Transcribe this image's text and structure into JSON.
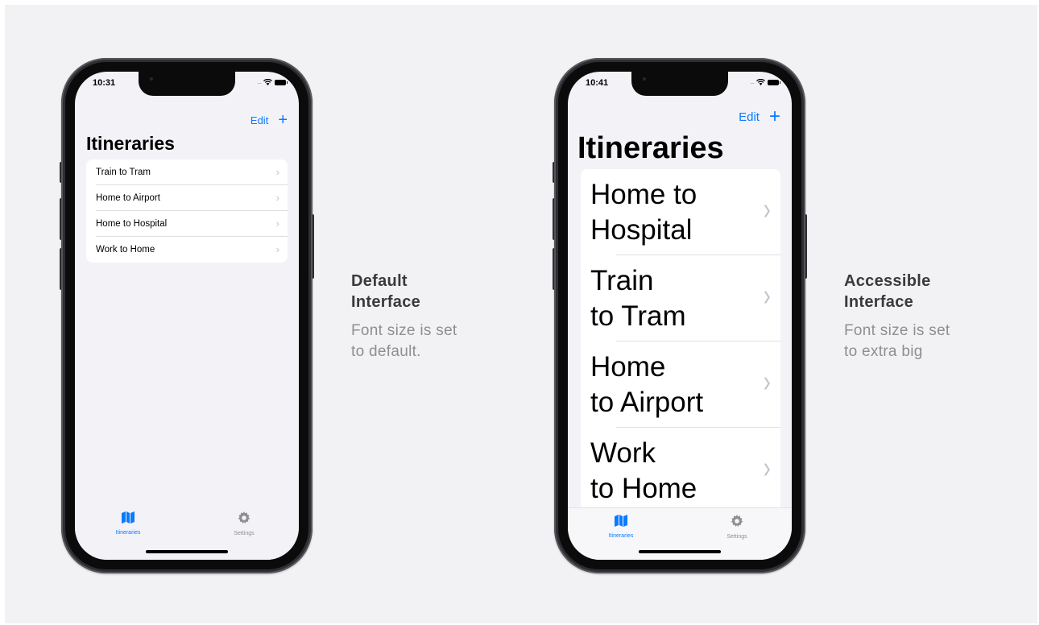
{
  "colors": {
    "accent": "#0a7aff",
    "background": "#f2f2f4",
    "phone_frame": "#2e2f33",
    "caption_heading": "#3a3a3c",
    "caption_text": "#8e8e93"
  },
  "phones": [
    {
      "status": {
        "time": "10:31",
        "signal": "....."
      },
      "nav": {
        "edit_label": "Edit",
        "add_label": "+"
      },
      "title": "Itineraries",
      "rows": [
        "Train to Tram",
        "Home to Airport",
        "Home to Hospital",
        "Work to Home"
      ],
      "tabs": [
        {
          "label": "Itineraries",
          "icon": "map-icon"
        },
        {
          "label": "Settings",
          "icon": "gear-icon"
        }
      ]
    },
    {
      "status": {
        "time": "10:41",
        "signal": "....."
      },
      "nav": {
        "edit_label": "Edit",
        "add_label": "+"
      },
      "title": "Itineraries",
      "rows": [
        {
          "line1": "Home to",
          "line2": "Hospital"
        },
        {
          "line1": "Train",
          "line2": "to Tram"
        },
        {
          "line1": "Home",
          "line2": "to Airport"
        },
        {
          "line1": "Work",
          "line2": "to Home"
        }
      ],
      "tabs": [
        {
          "label": "Itineraries",
          "icon": "map-icon"
        },
        {
          "label": "Settings",
          "icon": "gear-icon"
        }
      ]
    }
  ],
  "captions": [
    {
      "heading_line1": "Default",
      "heading_line2": "Interface",
      "desc_line1": "Font size is set",
      "desc_line2": "to default."
    },
    {
      "heading_line1": "Accessible",
      "heading_line2": "Interface",
      "desc_line1": "Font size is set",
      "desc_line2": "to extra big"
    }
  ]
}
